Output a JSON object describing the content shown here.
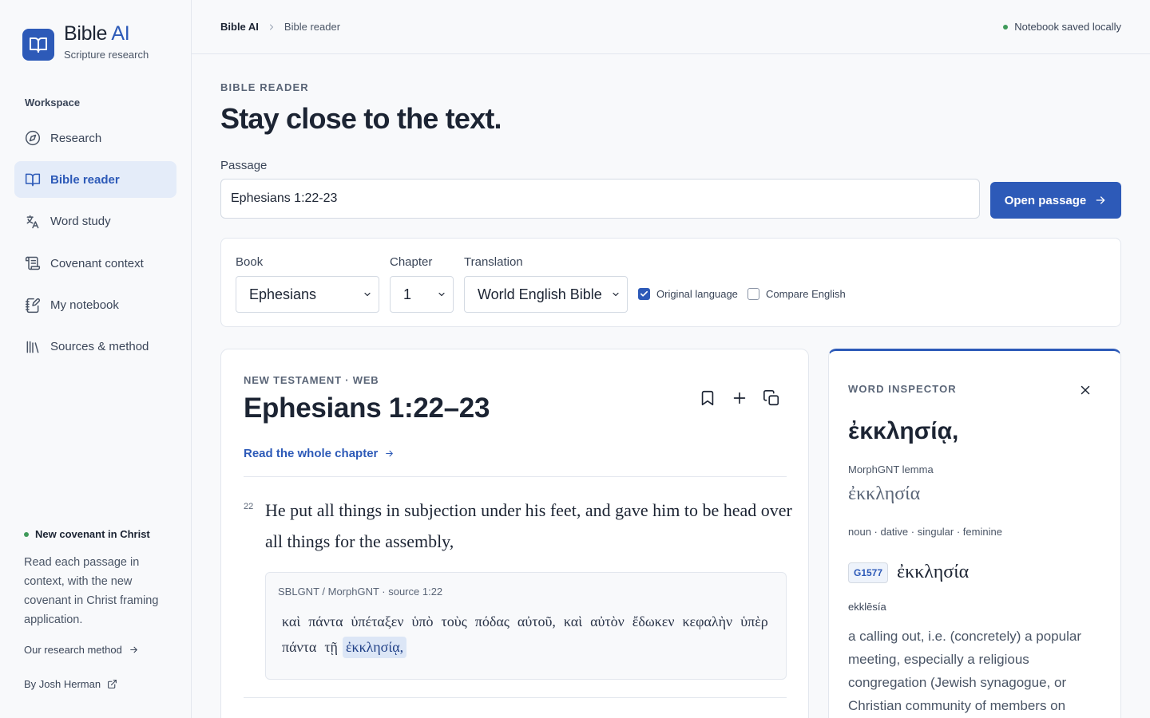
{
  "brand": {
    "name_main": "Bible",
    "name_accent": "AI",
    "tagline": "Scripture research"
  },
  "sidebar": {
    "section_label": "Workspace",
    "items": [
      {
        "label": "Research",
        "icon": "compass-icon",
        "active": false
      },
      {
        "label": "Bible reader",
        "icon": "book-open-icon",
        "active": true
      },
      {
        "label": "Word study",
        "icon": "translate-icon",
        "active": false
      },
      {
        "label": "Covenant context",
        "icon": "scroll-icon",
        "active": false
      },
      {
        "label": "My notebook",
        "icon": "notebook-pen-icon",
        "active": false
      },
      {
        "label": "Sources & method",
        "icon": "library-icon",
        "active": false
      }
    ],
    "footer": {
      "title": "New covenant in Christ",
      "text": "Read each passage in context, with the new covenant in Christ framing application.",
      "method_link": "Our research method",
      "author_link": "By Josh Herman"
    }
  },
  "topbar": {
    "breadcrumb_home": "Bible AI",
    "breadcrumb_current": "Bible reader",
    "status": "Notebook saved locally"
  },
  "header": {
    "eyebrow": "BIBLE READER",
    "title": "Stay close to the text."
  },
  "passage": {
    "label": "Passage",
    "value": "Ephesians 1:22-23",
    "button": "Open passage"
  },
  "filters": {
    "book_label": "Book",
    "book_value": "Ephesians",
    "chapter_label": "Chapter",
    "chapter_value": "1",
    "translation_label": "Translation",
    "translation_value": "World English Bible",
    "original_language": {
      "label": "Original language",
      "checked": true
    },
    "compare_english": {
      "label": "Compare English",
      "checked": false
    }
  },
  "reader": {
    "eyebrow": "NEW TESTAMENT · WEB",
    "title": "Ephesians 1:22–23",
    "chapter_link": "Read the whole chapter",
    "verse": {
      "number": "22",
      "text": "He put all things in subjection under his feet, and gave him to be head over all things for the assembly,",
      "original_source": "SBLGNT / MorphGNT · source 1:22",
      "words": [
        "καὶ",
        "πάντα",
        "ὑπέταξεν",
        "ὑπὸ",
        "τοὺς",
        "πόδας",
        "αὐτοῦ,",
        "καὶ",
        "αὐτὸν",
        "ἔδωκεν",
        "κεφαλὴν",
        "ὑπὲρ",
        "πάντα",
        "τῇ",
        "ἐκκλησίᾳ,"
      ],
      "selected_word_index": 14
    }
  },
  "inspector": {
    "eyebrow": "WORD INSPECTOR",
    "word": "ἐκκλησίᾳ,",
    "lemma_label": "MorphGNT lemma",
    "lemma": "ἐκκλησία",
    "parsing": "noun · dative · singular · feminine",
    "strongs": "G1577",
    "strongs_word": "ἐκκλησία",
    "transliteration": "ekklēsía",
    "definition": "a calling out, i.e. (concretely) a popular meeting, especially a religious congregation (Jewish synagogue, or Christian community of members on"
  },
  "colors": {
    "accent": "#2d5ab8",
    "active_bg": "#e4ecf9",
    "status_dot": "#3f9a5a",
    "selected_word_bg": "#dce6f6"
  }
}
